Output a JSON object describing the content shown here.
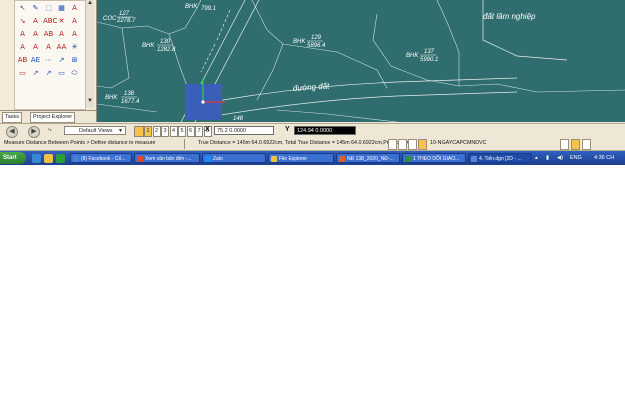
{
  "palette": {
    "tools": [
      {
        "glyph": "↖",
        "color": "gray"
      },
      {
        "glyph": "✎",
        "color": "blue"
      },
      {
        "glyph": "⬚",
        "color": "blue"
      },
      {
        "glyph": "▦",
        "color": "blue"
      },
      {
        "glyph": "A",
        "color": "red"
      },
      {
        "glyph": "↘",
        "color": "red"
      },
      {
        "glyph": "A",
        "color": "red"
      },
      {
        "glyph": "ABC",
        "color": "red"
      },
      {
        "glyph": "✕",
        "color": "red"
      },
      {
        "glyph": "A",
        "color": "red"
      },
      {
        "glyph": "A",
        "color": "red"
      },
      {
        "glyph": "A",
        "color": "red"
      },
      {
        "glyph": "AB",
        "color": "red"
      },
      {
        "glyph": "A",
        "color": "red"
      },
      {
        "glyph": "A",
        "color": "red"
      },
      {
        "glyph": "A",
        "color": "red"
      },
      {
        "glyph": "A",
        "color": "red"
      },
      {
        "glyph": "A",
        "color": "red"
      },
      {
        "glyph": "AA",
        "color": "red"
      },
      {
        "glyph": "✳",
        "color": "blue"
      },
      {
        "glyph": "AB",
        "color": "red"
      },
      {
        "glyph": "AE",
        "color": "blue"
      },
      {
        "glyph": "⋯",
        "color": "blue"
      },
      {
        "glyph": "↗",
        "color": "blue"
      },
      {
        "glyph": "⊞",
        "color": "blue"
      },
      {
        "glyph": "▭",
        "color": "red"
      },
      {
        "glyph": "↗",
        "color": "blue"
      },
      {
        "glyph": "↗",
        "color": "blue"
      },
      {
        "glyph": "▭",
        "color": "blue"
      },
      {
        "glyph": "⬭",
        "color": "blue"
      }
    ],
    "tabs": {
      "tasks": "Tasks",
      "explorer": "Project Explorer"
    }
  },
  "map": {
    "parcels": [
      {
        "name": "COC",
        "top": "127",
        "bottom": "2278.7"
      },
      {
        "name": "BHK",
        "top": "",
        "bottom": "799.1"
      },
      {
        "name": "BHK",
        "top": "130",
        "bottom": "1282.8"
      },
      {
        "name": "BHK",
        "top": "129",
        "bottom": "5896.4"
      },
      {
        "name": "BHK",
        "top": "137",
        "bottom": "5990.1"
      },
      {
        "name": "BHK",
        "top": "138",
        "bottom": "1677.4"
      }
    ],
    "forest_label": "đất lâm nghiệp",
    "road_label": "đường đất",
    "partial_label": "148"
  },
  "toolbar": {
    "default_views": "Default Views",
    "pages": [
      "1",
      "2",
      "3",
      "4",
      "5",
      "6",
      "7",
      "8"
    ],
    "active_page": "1",
    "x_label": "X",
    "x_value": "75.2 0.0000",
    "y_label": "Y",
    "y_value": "124.94 0.0000"
  },
  "status": {
    "hint": "Measure Distance Between Points > Define distance to measure",
    "distance": "True Distance = 145m  64.0.6922cm, Total True Distance = 145m  64.0.6922cm,Projected C",
    "level": "10-NGAYCAPCMNDVC"
  },
  "taskbar": {
    "start": "Start",
    "tasks": [
      {
        "label": "(8) Facebook - Cố...",
        "color": "#4a7fd8"
      },
      {
        "label": "Xem văn bản đến -...",
        "color": "#e04a2a"
      },
      {
        "label": "Zalo",
        "color": "#1a8cff"
      },
      {
        "label": "File Explorer",
        "color": "#f0c040"
      },
      {
        "label": "NĐ 138_2020_NĐ-...",
        "color": "#e06020"
      },
      {
        "label": "1 THEO DÕI GIAO...",
        "color": "#2f8f3f"
      },
      {
        "label": "4. Tiến.dgn [2D - ...",
        "color": "#5a86d8"
      }
    ],
    "lang": "ENG",
    "time": "4:36 CH"
  },
  "colors": {
    "map_bg": "#2f6d6e",
    "highlight": "#3a5fb8",
    "accent": "#f6c248"
  }
}
